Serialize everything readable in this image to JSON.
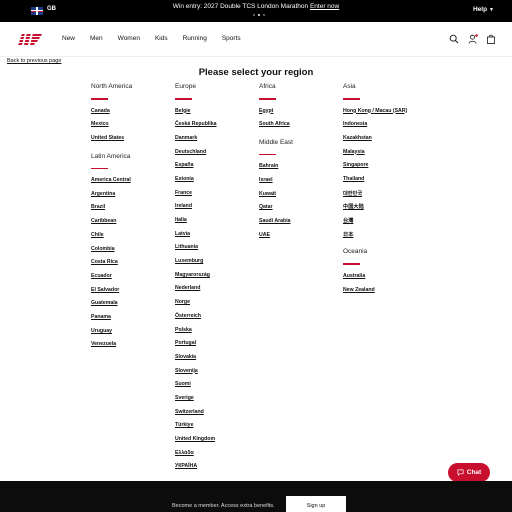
{
  "topbar": {
    "country_code": "GB",
    "promo_text": "Win entry: 2027 Double TCS London Marathon",
    "promo_link": "Enter now",
    "help_label": "Help"
  },
  "nav": {
    "items": [
      "New",
      "Men",
      "Women",
      "Kids",
      "Running",
      "Sports"
    ]
  },
  "page": {
    "back_link": "Back to previous page",
    "title": "Please select your region"
  },
  "regions": {
    "north_america": {
      "name": "North America",
      "countries": [
        "Canada",
        "Mexico",
        "United States"
      ]
    },
    "latin_america": {
      "name": "Latin America",
      "countries": [
        "America Central",
        "Argentina",
        "Brazil",
        "Caribbean",
        "Chile",
        "Colombia",
        "Costa Rica",
        "Ecuador",
        "El Salvador",
        "Guatemala",
        "Panama",
        "Uruguay",
        "Venezuela"
      ]
    },
    "europe": {
      "name": "Europe",
      "countries": [
        "Belgie",
        "Česká Republika",
        "Danmark",
        "Deutschland",
        "España",
        "Estonia",
        "France",
        "Ireland",
        "Italia",
        "Latvia",
        "Lithuania",
        "Luxemburg",
        "Magyarország",
        "Nederland",
        "Norge",
        "Österreich",
        "Polska",
        "Portugal",
        "Slovakia",
        "Slovenija",
        "Suomi",
        "Sverige",
        "Switzerland",
        "Türkiye",
        "United Kingdom",
        "Ελλάδα",
        "УКРАЇНА"
      ]
    },
    "africa": {
      "name": "Africa",
      "countries": [
        "Egypt",
        "South Africa"
      ]
    },
    "middle_east": {
      "name": "Middle East",
      "countries": [
        "Bahrain",
        "Israel",
        "Kuwait",
        "Qatar",
        "Saudi Arabia",
        "UAE"
      ]
    },
    "asia": {
      "name": "Asia",
      "countries": [
        "Hong Kong / Macau (SAR)",
        "Indonesia",
        "Kazakhstan",
        "Malaysia",
        "Singapore",
        "Thailand",
        "대한민국",
        "中国大陆",
        "台灣",
        "日本"
      ]
    },
    "oceania": {
      "name": "Oceania",
      "countries": [
        "Australia",
        "New Zealand"
      ]
    }
  },
  "chat": {
    "label": "Chat"
  },
  "footer": {
    "message": "Become a member. Access extra benefits.",
    "signup_label": "Sign up"
  },
  "colors": {
    "brand_red": "#c8102e",
    "topbar_bg": "#000000",
    "footer_bg": "#0c0c0c"
  }
}
